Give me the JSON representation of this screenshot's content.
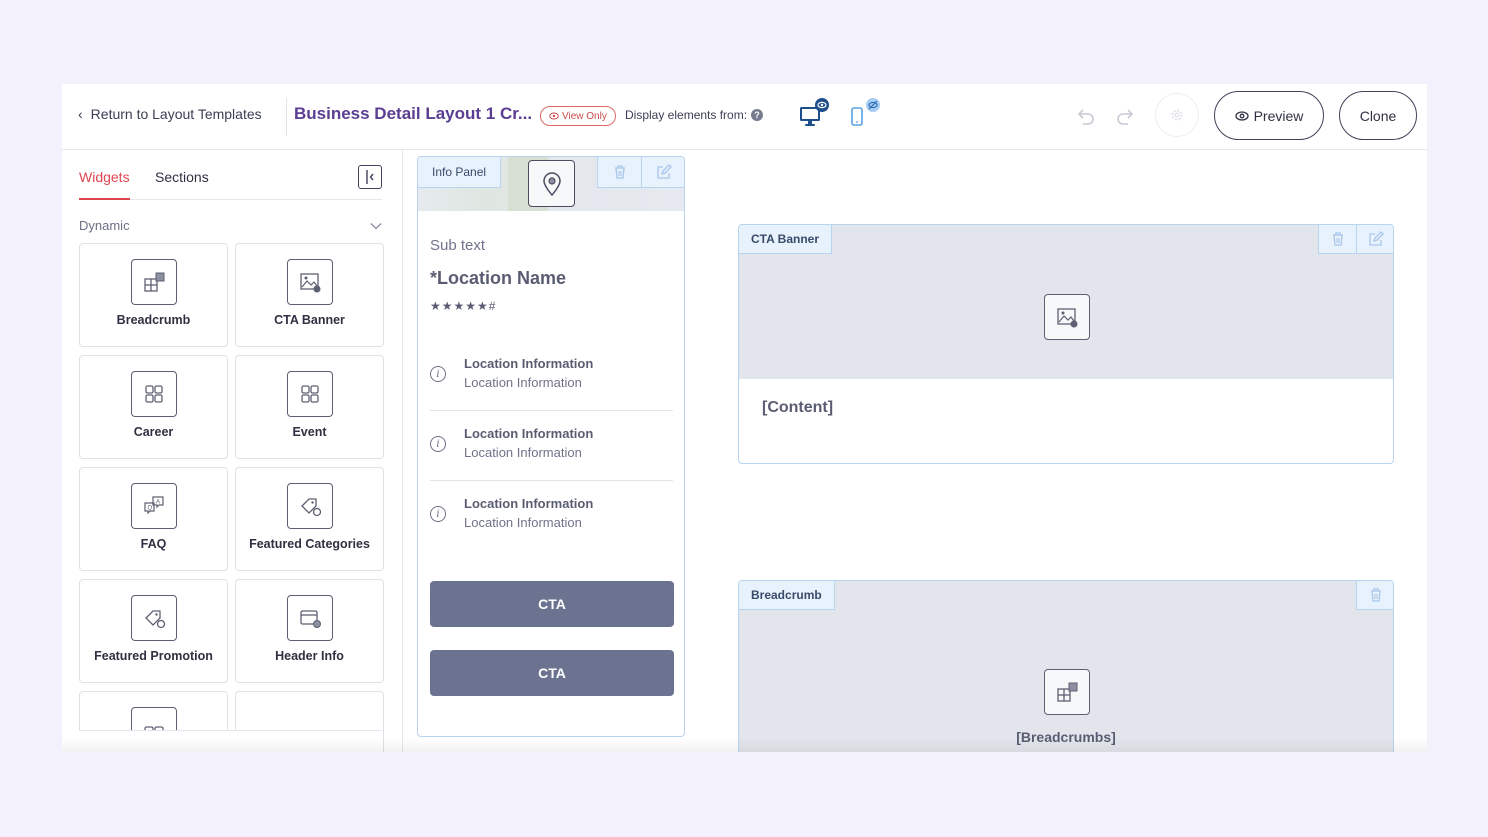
{
  "topbar": {
    "back_label": "Return to Layout Templates",
    "layout_title": "Business Detail Layout 1 Cr...",
    "view_only_label": "View Only",
    "display_from_label": "Display elements from:",
    "help_glyph": "?",
    "preview_label": "Preview",
    "clone_label": "Clone"
  },
  "sidebar": {
    "tabs": [
      {
        "label": "Widgets",
        "active": true
      },
      {
        "label": "Sections",
        "active": false
      }
    ],
    "section_title": "Dynamic",
    "widgets": [
      {
        "label": "Breadcrumb",
        "icon": "breadcrumb-icon"
      },
      {
        "label": "CTA Banner",
        "icon": "image-icon"
      },
      {
        "label": "Career",
        "icon": "grid-icon"
      },
      {
        "label": "Event",
        "icon": "grid-icon"
      },
      {
        "label": "FAQ",
        "icon": "faq-chat-icon"
      },
      {
        "label": "Featured Categories",
        "icon": "tag-icon"
      },
      {
        "label": "Featured Promotion",
        "icon": "tag-icon"
      },
      {
        "label": "Header Info",
        "icon": "card-icon"
      },
      {
        "label": "",
        "icon": "widget-icon"
      },
      {
        "label": "",
        "icon": ""
      }
    ]
  },
  "info_panel": {
    "tag": "Info Panel",
    "sub_text": "Sub text",
    "location_name": "*Location Name",
    "rating": "★★★★★#",
    "rows": [
      {
        "title": "Location Information",
        "value": "Location Information"
      },
      {
        "title": "Location Information",
        "value": "Location Information"
      },
      {
        "title": "Location Information",
        "value": "Location Information"
      }
    ],
    "cta_1": "CTA",
    "cta_2": "CTA"
  },
  "cta_banner": {
    "tag": "CTA Banner",
    "content": "[Content]"
  },
  "breadcrumb_block": {
    "tag": "Breadcrumb",
    "content": "[Breadcrumbs]"
  },
  "colors": {
    "accent": "#e0454f",
    "title": "#5b3d92",
    "cta": "#6b7391",
    "device_active": "#1f4f8a",
    "device_inactive": "#5aa2e6"
  }
}
